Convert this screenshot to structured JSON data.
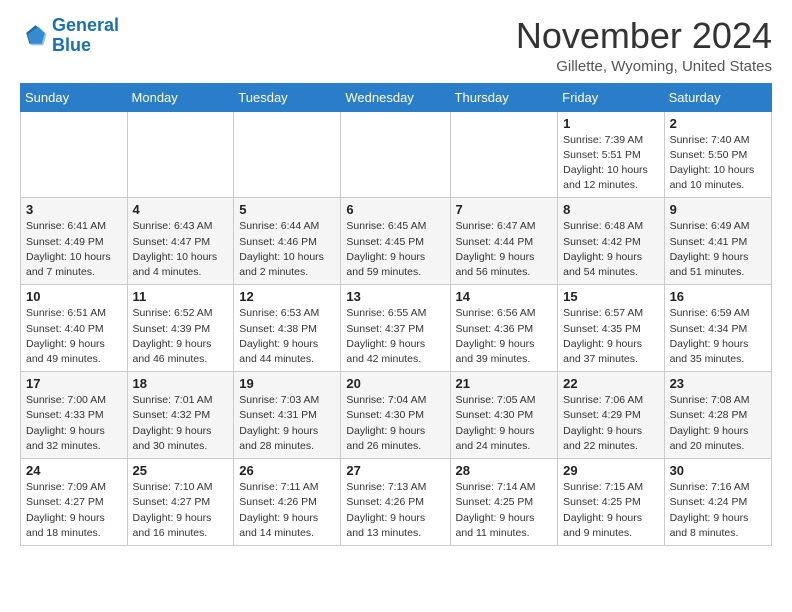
{
  "logo": {
    "line1": "General",
    "line2": "Blue"
  },
  "title": "November 2024",
  "location": "Gillette, Wyoming, United States",
  "days_of_week": [
    "Sunday",
    "Monday",
    "Tuesday",
    "Wednesday",
    "Thursday",
    "Friday",
    "Saturday"
  ],
  "weeks": [
    [
      {
        "day": "",
        "info": ""
      },
      {
        "day": "",
        "info": ""
      },
      {
        "day": "",
        "info": ""
      },
      {
        "day": "",
        "info": ""
      },
      {
        "day": "",
        "info": ""
      },
      {
        "day": "1",
        "info": "Sunrise: 7:39 AM\nSunset: 5:51 PM\nDaylight: 10 hours and 12 minutes."
      },
      {
        "day": "2",
        "info": "Sunrise: 7:40 AM\nSunset: 5:50 PM\nDaylight: 10 hours and 10 minutes."
      }
    ],
    [
      {
        "day": "3",
        "info": "Sunrise: 6:41 AM\nSunset: 4:49 PM\nDaylight: 10 hours and 7 minutes."
      },
      {
        "day": "4",
        "info": "Sunrise: 6:43 AM\nSunset: 4:47 PM\nDaylight: 10 hours and 4 minutes."
      },
      {
        "day": "5",
        "info": "Sunrise: 6:44 AM\nSunset: 4:46 PM\nDaylight: 10 hours and 2 minutes."
      },
      {
        "day": "6",
        "info": "Sunrise: 6:45 AM\nSunset: 4:45 PM\nDaylight: 9 hours and 59 minutes."
      },
      {
        "day": "7",
        "info": "Sunrise: 6:47 AM\nSunset: 4:44 PM\nDaylight: 9 hours and 56 minutes."
      },
      {
        "day": "8",
        "info": "Sunrise: 6:48 AM\nSunset: 4:42 PM\nDaylight: 9 hours and 54 minutes."
      },
      {
        "day": "9",
        "info": "Sunrise: 6:49 AM\nSunset: 4:41 PM\nDaylight: 9 hours and 51 minutes."
      }
    ],
    [
      {
        "day": "10",
        "info": "Sunrise: 6:51 AM\nSunset: 4:40 PM\nDaylight: 9 hours and 49 minutes."
      },
      {
        "day": "11",
        "info": "Sunrise: 6:52 AM\nSunset: 4:39 PM\nDaylight: 9 hours and 46 minutes."
      },
      {
        "day": "12",
        "info": "Sunrise: 6:53 AM\nSunset: 4:38 PM\nDaylight: 9 hours and 44 minutes."
      },
      {
        "day": "13",
        "info": "Sunrise: 6:55 AM\nSunset: 4:37 PM\nDaylight: 9 hours and 42 minutes."
      },
      {
        "day": "14",
        "info": "Sunrise: 6:56 AM\nSunset: 4:36 PM\nDaylight: 9 hours and 39 minutes."
      },
      {
        "day": "15",
        "info": "Sunrise: 6:57 AM\nSunset: 4:35 PM\nDaylight: 9 hours and 37 minutes."
      },
      {
        "day": "16",
        "info": "Sunrise: 6:59 AM\nSunset: 4:34 PM\nDaylight: 9 hours and 35 minutes."
      }
    ],
    [
      {
        "day": "17",
        "info": "Sunrise: 7:00 AM\nSunset: 4:33 PM\nDaylight: 9 hours and 32 minutes."
      },
      {
        "day": "18",
        "info": "Sunrise: 7:01 AM\nSunset: 4:32 PM\nDaylight: 9 hours and 30 minutes."
      },
      {
        "day": "19",
        "info": "Sunrise: 7:03 AM\nSunset: 4:31 PM\nDaylight: 9 hours and 28 minutes."
      },
      {
        "day": "20",
        "info": "Sunrise: 7:04 AM\nSunset: 4:30 PM\nDaylight: 9 hours and 26 minutes."
      },
      {
        "day": "21",
        "info": "Sunrise: 7:05 AM\nSunset: 4:30 PM\nDaylight: 9 hours and 24 minutes."
      },
      {
        "day": "22",
        "info": "Sunrise: 7:06 AM\nSunset: 4:29 PM\nDaylight: 9 hours and 22 minutes."
      },
      {
        "day": "23",
        "info": "Sunrise: 7:08 AM\nSunset: 4:28 PM\nDaylight: 9 hours and 20 minutes."
      }
    ],
    [
      {
        "day": "24",
        "info": "Sunrise: 7:09 AM\nSunset: 4:27 PM\nDaylight: 9 hours and 18 minutes."
      },
      {
        "day": "25",
        "info": "Sunrise: 7:10 AM\nSunset: 4:27 PM\nDaylight: 9 hours and 16 minutes."
      },
      {
        "day": "26",
        "info": "Sunrise: 7:11 AM\nSunset: 4:26 PM\nDaylight: 9 hours and 14 minutes."
      },
      {
        "day": "27",
        "info": "Sunrise: 7:13 AM\nSunset: 4:26 PM\nDaylight: 9 hours and 13 minutes."
      },
      {
        "day": "28",
        "info": "Sunrise: 7:14 AM\nSunset: 4:25 PM\nDaylight: 9 hours and 11 minutes."
      },
      {
        "day": "29",
        "info": "Sunrise: 7:15 AM\nSunset: 4:25 PM\nDaylight: 9 hours and 9 minutes."
      },
      {
        "day": "30",
        "info": "Sunrise: 7:16 AM\nSunset: 4:24 PM\nDaylight: 9 hours and 8 minutes."
      }
    ]
  ]
}
